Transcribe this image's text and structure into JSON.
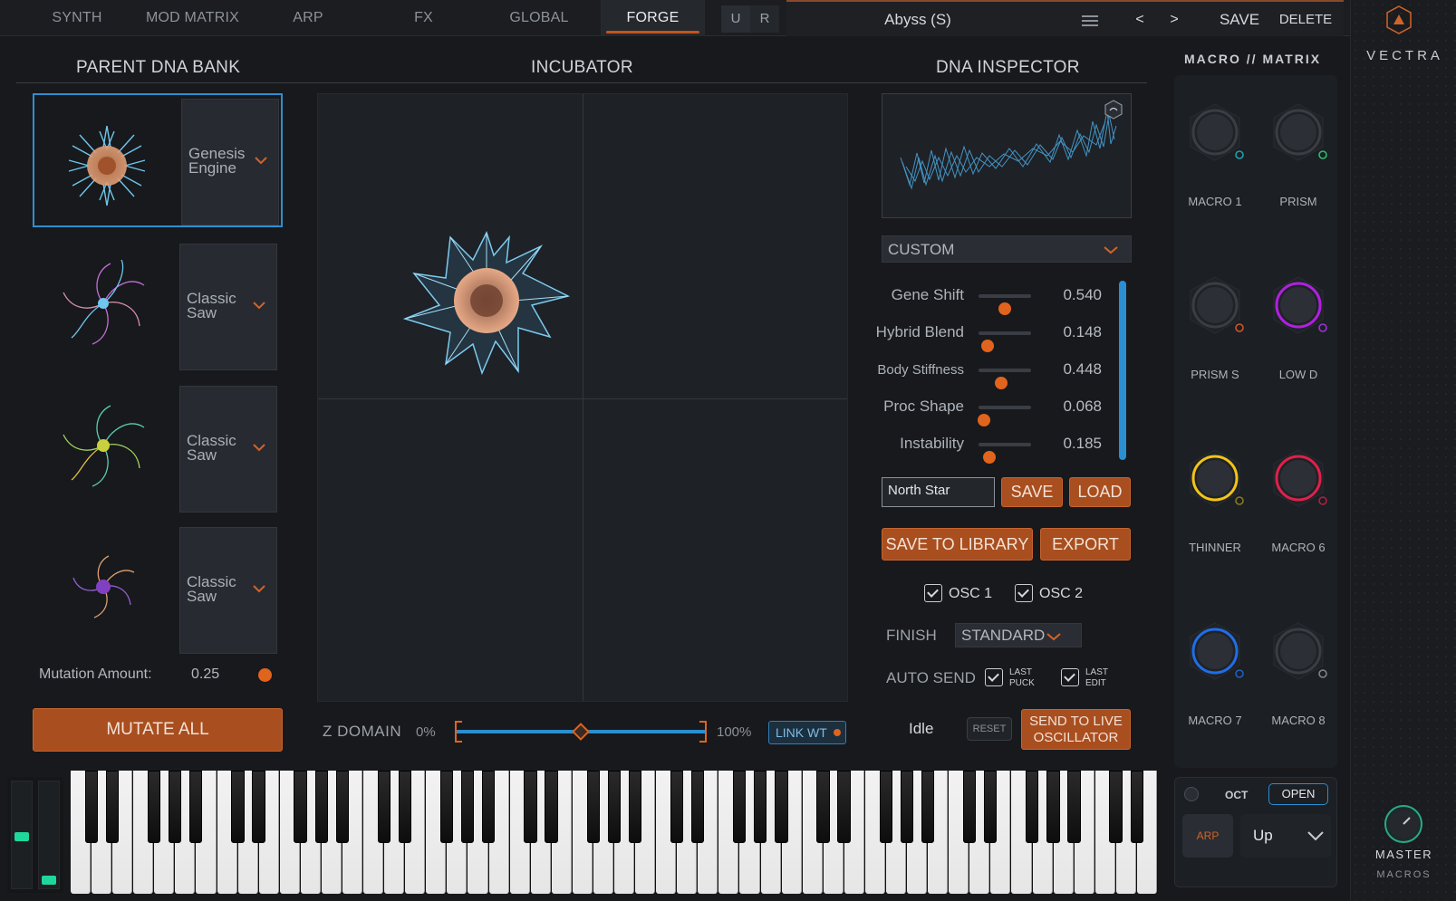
{
  "tabs": [
    {
      "label": "SYNTH"
    },
    {
      "label": "MOD MATRIX"
    },
    {
      "label": "ARP"
    },
    {
      "label": "FX"
    },
    {
      "label": "GLOBAL"
    },
    {
      "label": "FORGE"
    }
  ],
  "active_tab": "FORGE",
  "undo_label": "U",
  "redo_label": "R",
  "preset": {
    "name": "Abyss (S)",
    "prev": "<",
    "next": ">",
    "save": "SAVE",
    "delete": "DELETE",
    "menu_icon": "hamburger-icon"
  },
  "brand": {
    "name": "VECTRA",
    "logo_icon": "triangle-logo-icon"
  },
  "parent_bank": {
    "title": "PARENT DNA BANK",
    "slots": [
      {
        "engine_line1": "Genesis",
        "engine_line2": "Engine",
        "selected": true
      },
      {
        "engine_line1": "Classic",
        "engine_line2": "Saw",
        "selected": false
      },
      {
        "engine_line1": "Classic",
        "engine_line2": "Saw",
        "selected": false
      },
      {
        "engine_line1": "Classic",
        "engine_line2": "Saw",
        "selected": false
      }
    ],
    "mutation_label": "Mutation Amount:",
    "mutation_value": "0.25",
    "mutate_all": "MUTATE ALL"
  },
  "incubator": {
    "title": "INCUBATOR",
    "z_domain_label": "Z DOMAIN",
    "z_min": "0%",
    "z_max": "100%",
    "z_value": 0.5,
    "link_wt": "LINK WT"
  },
  "inspector": {
    "title": "DNA INSPECTOR",
    "mode": "CUSTOM",
    "params": [
      {
        "label": "Gene Shift",
        "value": "0.540",
        "level": 0.54
      },
      {
        "label": "Hybrid Blend",
        "value": "0.148",
        "level": 0.148
      },
      {
        "label": "Body Stiffness",
        "value": "0.448",
        "level": 0.448
      },
      {
        "label": "Proc Shape",
        "value": "0.068",
        "level": 0.068
      },
      {
        "label": "Instability",
        "value": "0.185",
        "level": 0.185
      }
    ],
    "name_value": "North Star",
    "save": "SAVE",
    "load": "LOAD",
    "save_library": "SAVE TO LIBRARY",
    "export": "EXPORT",
    "osc1": "OSC 1",
    "osc2": "OSC 2",
    "finish_label": "FINISH",
    "finish_value": "STANDARD",
    "auto_send_label": "AUTO SEND",
    "last_puck_1": "LAST",
    "last_puck_2": "PUCK",
    "last_edit_1": "LAST",
    "last_edit_2": "EDIT",
    "status": "Idle",
    "reset": "RESET",
    "send_line1": "SEND TO LIVE",
    "send_line2": "OSCILLATOR"
  },
  "macros": {
    "title": "MACRO // MATRIX",
    "knobs": [
      {
        "label": "MACRO 1",
        "color": "#3a3d44",
        "dot": "#1fa0b0"
      },
      {
        "label": "PRISM",
        "color": "#3a3d44",
        "dot": "#2bbf6a"
      },
      {
        "label": "PRISM S",
        "color": "#3a3d44",
        "dot": "#d0542a"
      },
      {
        "label": "LOW D",
        "color": "#b020e0",
        "dot": "#a030e0"
      },
      {
        "label": "THINNER",
        "color": "#f2c418",
        "dot": "#8a7a20"
      },
      {
        "label": "MACRO 6",
        "color": "#e0204a",
        "dot": "#b02040"
      },
      {
        "label": "MACRO 7",
        "color": "#1f6ee8",
        "dot": "#2060c0"
      },
      {
        "label": "MACRO 8",
        "color": "#3a3d44",
        "dot": "#80858c"
      }
    ]
  },
  "arp": {
    "oct_label": "OCT",
    "open": "OPEN",
    "arp": "ARP",
    "direction": "Up"
  },
  "master": {
    "label": "MASTER",
    "sub": "MACROS"
  }
}
